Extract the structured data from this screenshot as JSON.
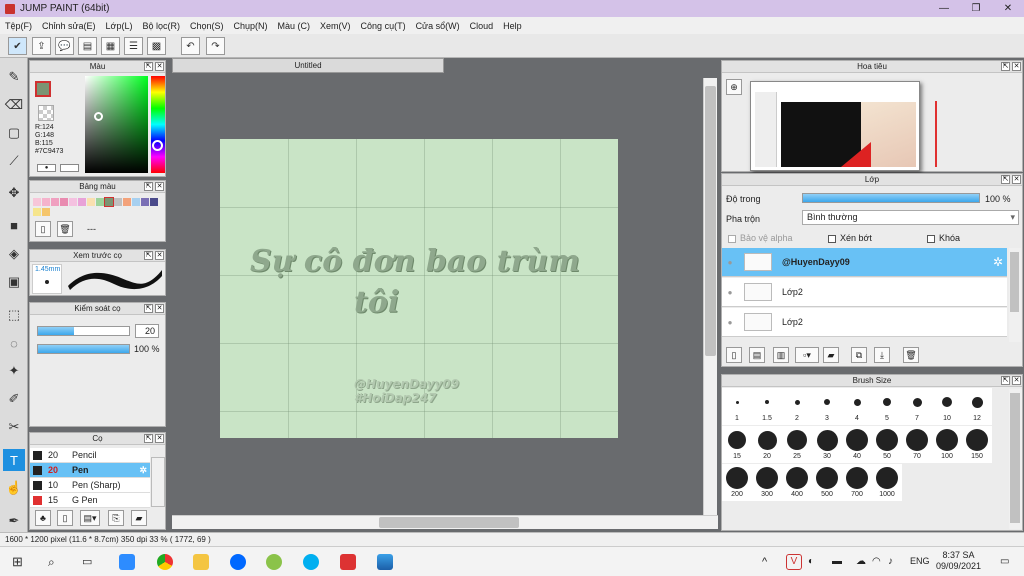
{
  "window": {
    "title": "JUMP PAINT (64bit)",
    "controls": [
      "—",
      "❐",
      "✕"
    ]
  },
  "menu": [
    "Tệp(F)",
    "Chỉnh sửa(E)",
    "Lớp(L)",
    "Bộ lọc(R)",
    "Chọn(S)",
    "Chụp(N)",
    "Màu (C)",
    "Xem(V)",
    "Công cụ(T)",
    "Cửa sổ(W)",
    "Cloud",
    "Help"
  ],
  "document": {
    "tab": "Untitled",
    "text_line1": "Sự cô đơn bao trùm",
    "text_line2": "tôi",
    "watermark1": "@HuyenDayy09",
    "watermark2": "#HoiDap247"
  },
  "color_panel": {
    "title": "Màu",
    "r": "R:124",
    "g": "G:148",
    "b": "B:115",
    "hex": "#7C9473"
  },
  "palette_panel": {
    "title": "Bảng màu",
    "swatches": [
      "#f7c6d9",
      "#f5b3cc",
      "#f0a0c0",
      "#e98bb0",
      "#f4c1e0",
      "#e8a2d8",
      "#f9e0b0",
      "#9ed39b",
      "#7c9473",
      "#c0c0c0",
      "#f3a27a",
      "#a7d0f0",
      "#7a6fb5",
      "#4a4a8a",
      "#f6e58d",
      "#f5c56b"
    ],
    "more": "---"
  },
  "brush_preview": {
    "title": "Xem trước cọ",
    "size": "1.45mm"
  },
  "brush_control": {
    "title": "Kiểm soát cọ",
    "size_value": "20",
    "opacity_value": "100 %",
    "opacity": 1.0,
    "size_fill": 0.4
  },
  "brushes": {
    "title": "Cọ",
    "items": [
      {
        "size": "20",
        "name": "Pencil",
        "color": "#222222"
      },
      {
        "size": "20",
        "name": "Pen",
        "color": "#222222"
      },
      {
        "size": "10",
        "name": "Pen (Sharp)",
        "color": "#222222"
      },
      {
        "size": "15",
        "name": "G Pen",
        "color": "#e03030"
      }
    ]
  },
  "navigator": {
    "title": "Hoa tiêu"
  },
  "layers": {
    "title": "Lớp",
    "opacity_label": "Độ trong",
    "opacity_value": "100 %",
    "opacity": 1.0,
    "blend_label": "Pha trộn",
    "blend_value": "Bình thường",
    "protect_alpha": "Bảo vệ alpha",
    "clipping": "Xén bớt",
    "lock": "Khóa",
    "items": [
      {
        "name": "@HuyenDayy09",
        "selected": true
      },
      {
        "name": "Lớp2",
        "selected": false
      },
      {
        "name": "Lớp2",
        "selected": false
      }
    ]
  },
  "brush_size": {
    "title": "Brush Size",
    "sizes": [
      "1",
      "1.5",
      "2",
      "3",
      "4",
      "5",
      "7",
      "10",
      "12",
      "15",
      "20",
      "25",
      "30",
      "40",
      "50",
      "70",
      "100",
      "150",
      "200",
      "300",
      "400",
      "500",
      "700",
      "1000"
    ]
  },
  "status": {
    "text": "1600 * 1200 pixel   (11.6 * 8.7cm)   350 dpi   33 %   ( 1772, 69 )"
  },
  "taskbar": {
    "lang": "ENG",
    "time": "8:37 SA",
    "date": "09/09/2021"
  }
}
